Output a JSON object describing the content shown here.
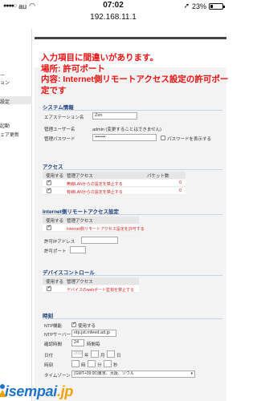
{
  "status_bar": {
    "carrier": "au",
    "time": "07:02",
    "battery": "23%",
    "battery_level": 0.23
  },
  "url": "192.168.11.1",
  "sidebar": {
    "items": [
      {
        "label": "ー"
      },
      {
        "label": "ョン"
      },
      {
        "label": "設定"
      },
      {
        "label": "起動"
      },
      {
        "label": "ェア更新"
      }
    ]
  },
  "error": {
    "line1": "入力項目に間違いがあります。",
    "line2": "場所: 許可ポート",
    "line3": "内容: Internet側リモートアクセス設定の許可ポー",
    "line4": "定です"
  },
  "system_info": {
    "title": "システム情報",
    "airstation_label": "エアステーション名",
    "airstation_value": "Zen",
    "admin_user_label": "管理ユーザー名",
    "admin_user_value": "admin (変更することはできません)",
    "admin_pass_label": "管理パスワード",
    "admin_pass_value": "•••••••",
    "show_password_label": "パスワードを表示する"
  },
  "access": {
    "title": "アクセス",
    "col_use": "使用する",
    "col_manage": "管理アクセス",
    "col_packets": "パケット数",
    "rows": [
      {
        "desc": "無線LANからの設定を禁止する",
        "count": "0"
      },
      {
        "desc": "有線LANからの設定を禁止する",
        "count": "0"
      }
    ]
  },
  "remote": {
    "title": "Internet側リモートアクセス設定",
    "col_use": "使用する",
    "col_manage": "管理アクセス",
    "row_desc": "Internet側リモートアクセス設定を許可する",
    "allowed_ip_label": "許可IPアドレス",
    "allowed_port_label": "許可ポート",
    "allowed_ip_value": "",
    "allowed_port_value": ""
  },
  "device_control": {
    "title": "デバイスコントロール",
    "col_use": "使用する",
    "col_manage": "管理アクセス",
    "row_desc": "デバイスのwebポート監視を禁止する"
  },
  "clock": {
    "title": "時刻",
    "ntp_label": "NTP機能",
    "ntp_use": "使用する",
    "ntp_server_label": "NTPサーバー",
    "ntp_server_value": "ntp.jst.mfeed.ad.jp",
    "interval_label": "確認時間",
    "interval_value": "24",
    "interval_unit": "時間毎",
    "date_label": "日付",
    "date_year": "年",
    "date_month": "月",
    "date_day": "日",
    "date_year_val": "2016",
    "date_month_val": "",
    "date_day_val": "",
    "time_label": "時刻",
    "time_h": "時",
    "time_m": "分",
    "time_s": "秒",
    "timezone_label": "タイムゾーン",
    "timezone_value": "(GMT+09:00)東京、大阪、ソウル"
  },
  "watermark": {
    "part1": "isempai",
    "part2": ".jp"
  }
}
